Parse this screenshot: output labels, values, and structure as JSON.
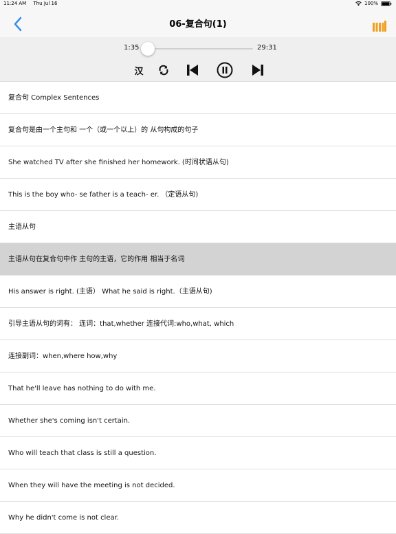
{
  "status_bar": {
    "time": "11:24 AM",
    "date": "Thu Jul 16",
    "battery": "100%"
  },
  "nav": {
    "title": "06-复合句(1)",
    "back_icon": "chevron-left-icon",
    "playlist_icon": "playlist-bars-icon",
    "accent_color": "#3a8ee6",
    "playlist_color": "#f0a020"
  },
  "player": {
    "elapsed": "1:35",
    "total": "29:31",
    "progress_fraction": 0.054,
    "lang_toggle_label": "汉",
    "controls": [
      "lang-toggle",
      "repeat-icon",
      "previous-track-icon",
      "pause-icon",
      "next-track-icon"
    ]
  },
  "sentences": [
    "复合句 Complex Sentences",
    "复合句是由一个主句和 一个（或一个以上）的 从句构成的句子",
    "She watched TV after she finished her homework. (时间状语从句)",
    "This is the boy who- se father is a teach- er. （定语从句)",
    "主语从句",
    "主语从句在复合句中作 主句的主语，它的作用 相当于名词",
    "His answer is right. (主语） What he said is right.（主语从句)",
    "引导主语从句的词有： 连词：that,whether 连接代词:who,what,          which",
    "连接副词：when,where          how,why",
    "That he'll leave has nothing to do with me.",
    "Whether she's coming isn't certain.",
    "Who will teach that class is still a question.",
    "When they will have the meeting is not decided.",
    "Why he didn't come is not clear."
  ],
  "active_index": 5
}
